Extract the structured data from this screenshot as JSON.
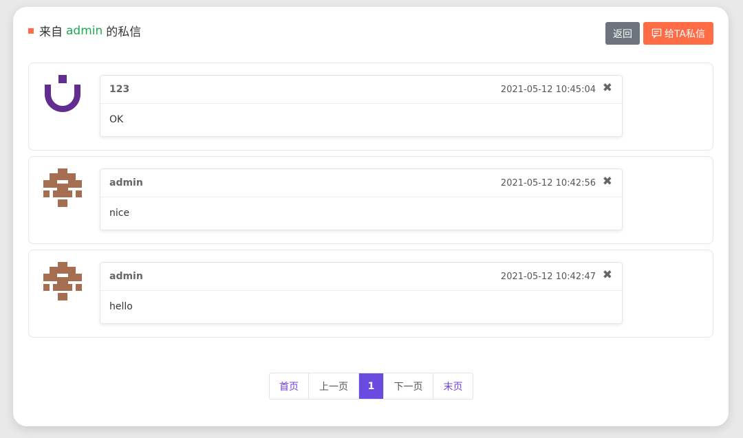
{
  "header": {
    "title_prefix": "来自",
    "title_user": "admin",
    "title_suffix": "的私信",
    "back_label": "返回",
    "message_label": "给TA私信"
  },
  "messages": [
    {
      "sender": "123",
      "time": "2021-05-12 10:45:04",
      "content": "OK",
      "avatar": "purple-identicon"
    },
    {
      "sender": "admin",
      "time": "2021-05-12 10:42:56",
      "content": "nice",
      "avatar": "brown-identicon"
    },
    {
      "sender": "admin",
      "time": "2021-05-12 10:42:47",
      "content": "hello",
      "avatar": "brown-identicon"
    }
  ],
  "close_glyph": "✖",
  "pagination": {
    "first": "首页",
    "prev": "上一页",
    "current": "1",
    "next": "下一页",
    "last": "末页"
  },
  "colors": {
    "accent": "#ff6b45",
    "username": "#1eaa55",
    "pager_active": "#6a4adf",
    "pager_link": "#7040e8",
    "avatar_purple": "#612d91",
    "avatar_brown": "#a56e50"
  }
}
